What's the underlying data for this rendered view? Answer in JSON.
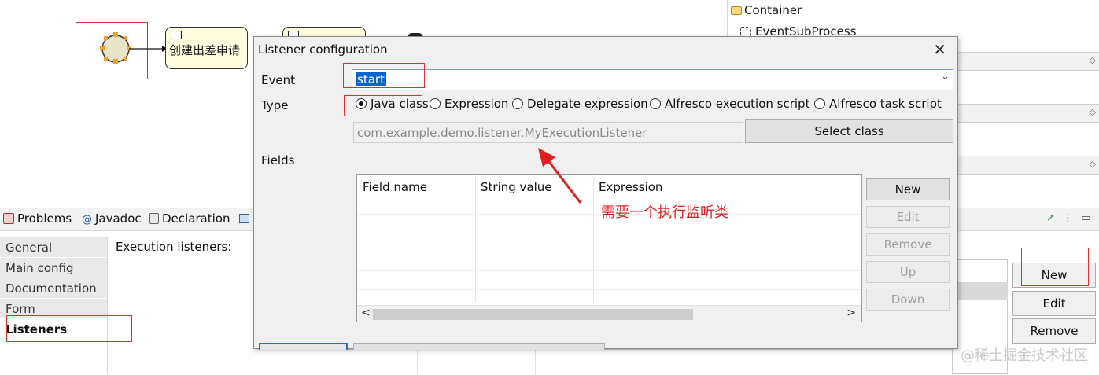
{
  "diagram": {
    "task1_label": "创建出差申请"
  },
  "outline": {
    "container_label": "Container",
    "event_subprocess_label": "EventSubProcess"
  },
  "views": {
    "tabs": [
      "Problems",
      "Javadoc",
      "Declaration"
    ]
  },
  "properties": {
    "nav": [
      "General",
      "Main config",
      "Documentation",
      "Form",
      "Listeners"
    ],
    "section_title": "Execution listeners:",
    "buttons": {
      "new": "New",
      "edit": "Edit",
      "remove": "Remove"
    }
  },
  "dialog": {
    "title": "Listener configuration",
    "event_label": "Event",
    "event_value": "start",
    "type_label": "Type",
    "type_options": [
      "Java class",
      "Expression",
      "Delegate expression",
      "Alfresco execution script",
      "Alfresco task script"
    ],
    "selected_type": "Java class",
    "class_value": "com.example.demo.listener.MyExecutionListener",
    "select_class_button": "Select class",
    "fields_label": "Fields",
    "columns": [
      "Field name",
      "String value",
      "Expression"
    ],
    "buttons": {
      "new": "New",
      "edit": "Edit",
      "remove": "Remove",
      "up": "Up",
      "down": "Down"
    }
  },
  "annotation": "需要一个执行监听类",
  "watermark": "@稀土掘金技术社区",
  "colors": {
    "annotation_red": "#e02020",
    "selection_blue": "#0a64d0",
    "task_fill": "#fffde0"
  }
}
